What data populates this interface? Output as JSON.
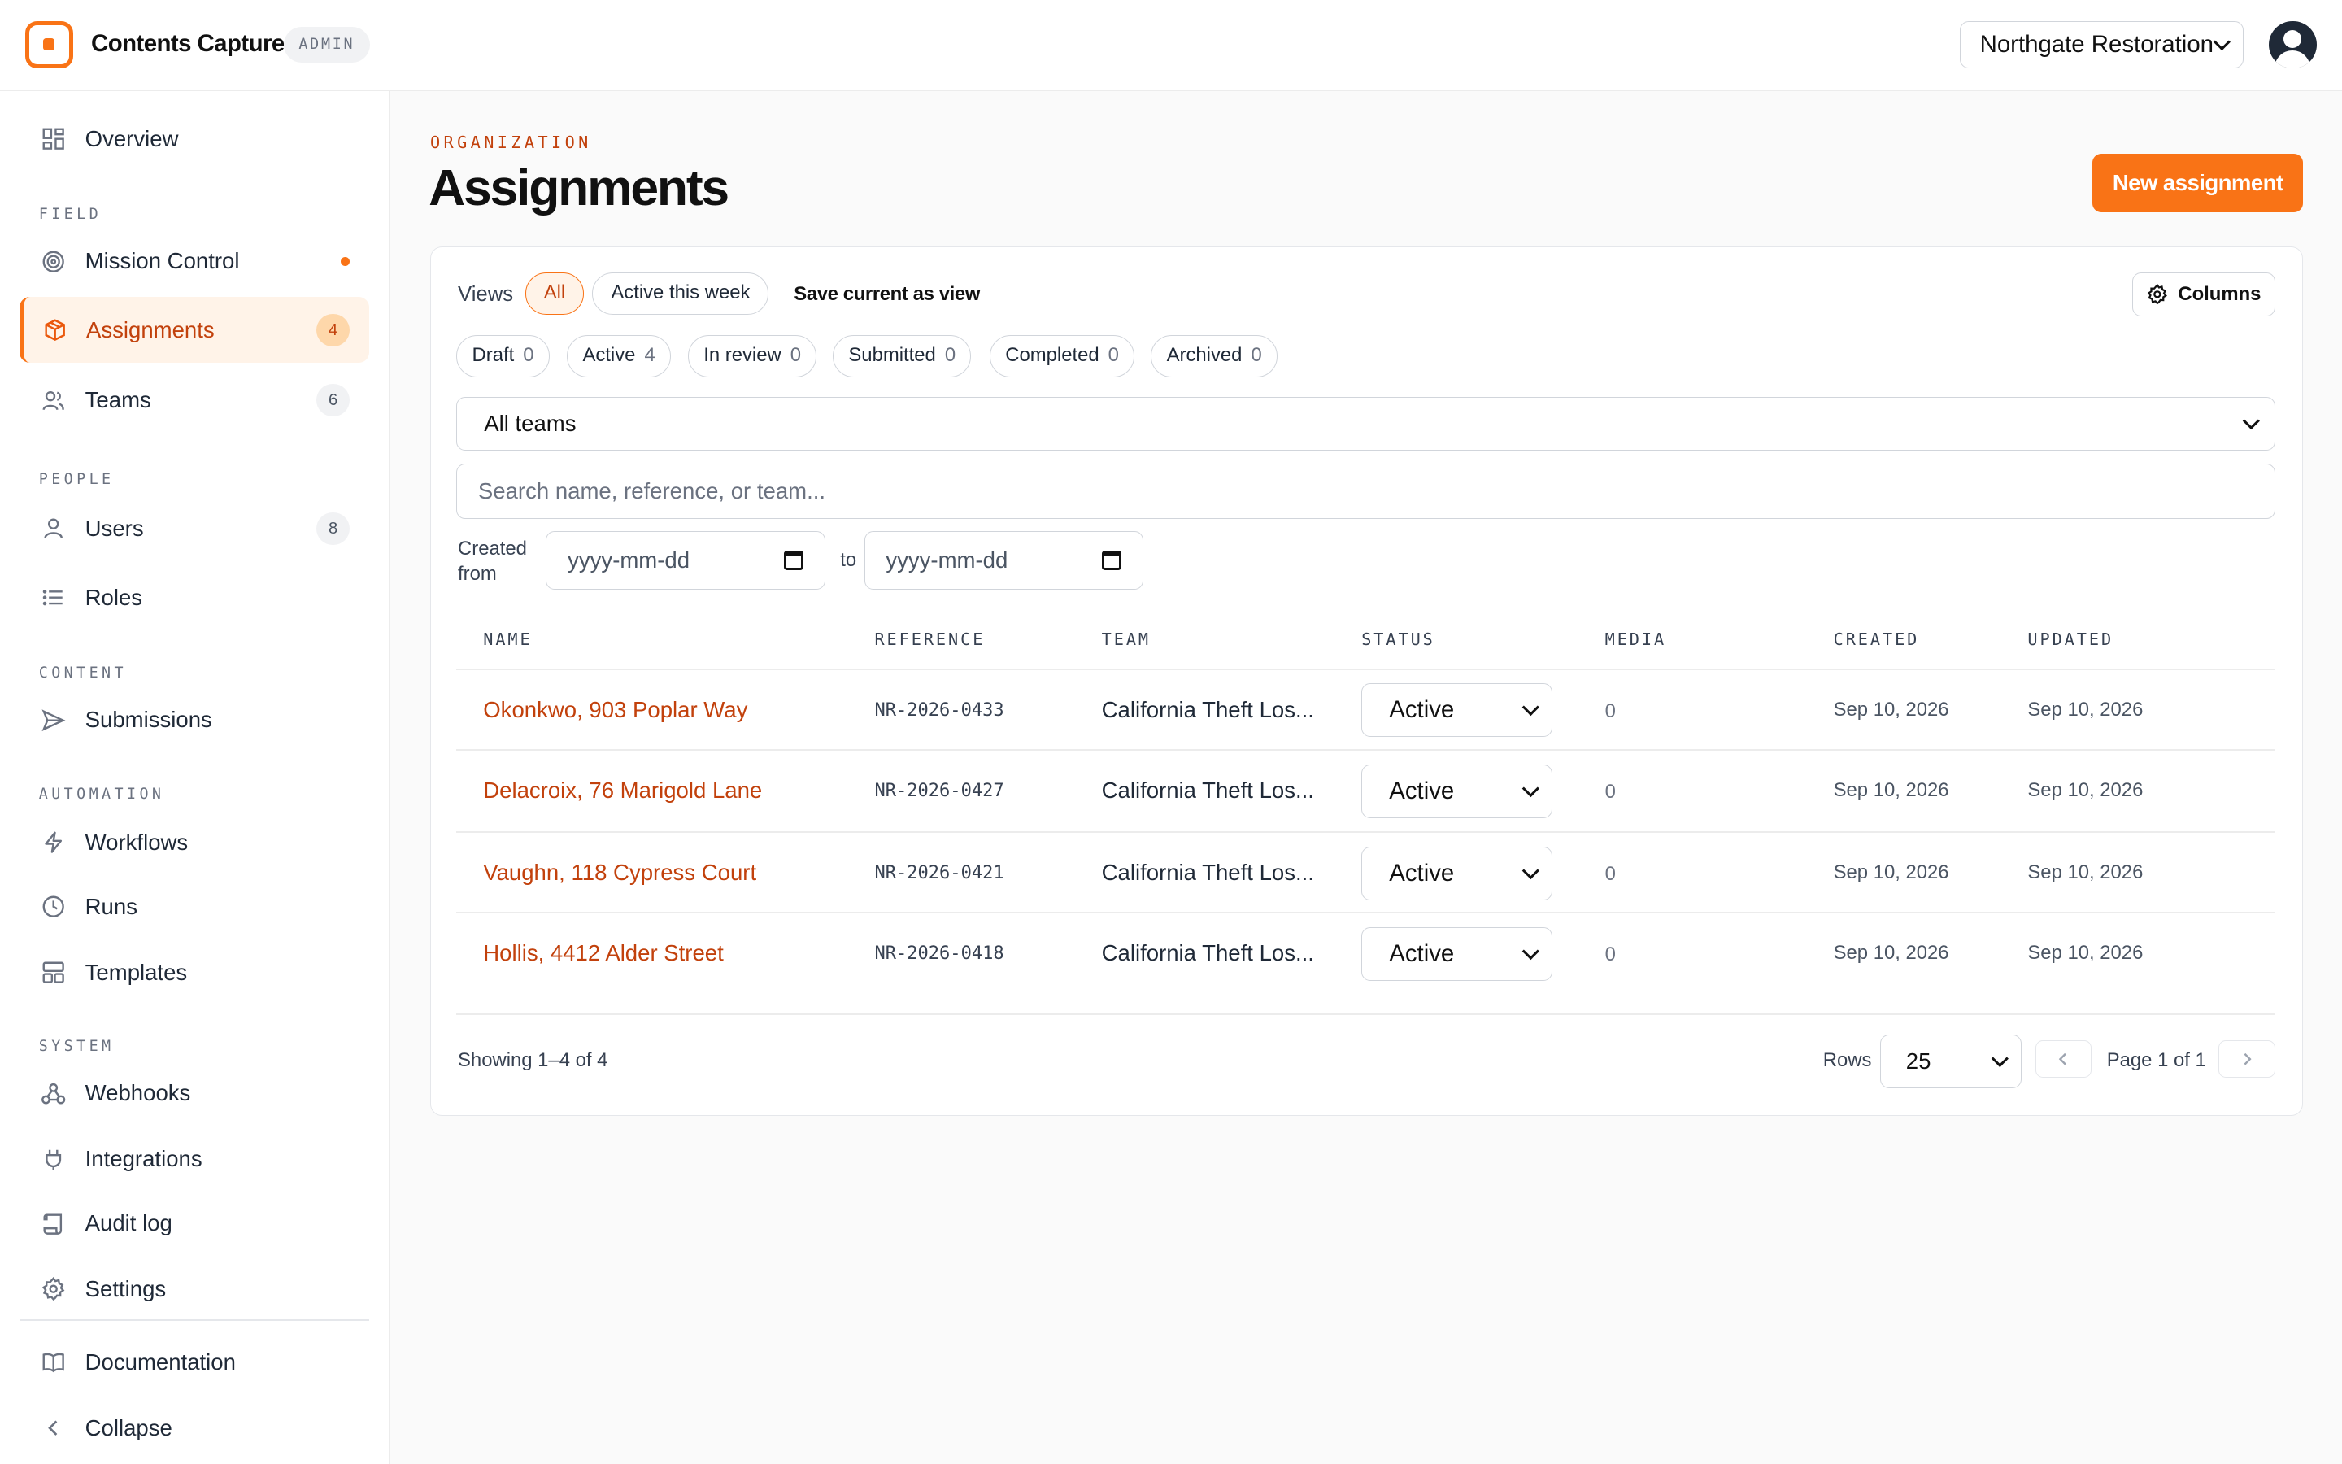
{
  "app": {
    "name": "Contents Capture",
    "badge": "ADMIN"
  },
  "org_selector": {
    "value": "Northgate Restoration"
  },
  "sidebar": {
    "overview": "Overview",
    "sections": {
      "field": "FIELD",
      "people": "PEOPLE",
      "content": "CONTENT",
      "automation": "AUTOMATION",
      "system": "SYSTEM"
    },
    "mission_control": "Mission Control",
    "assignments": {
      "label": "Assignments",
      "count": "4"
    },
    "teams": {
      "label": "Teams",
      "count": "6"
    },
    "users": {
      "label": "Users",
      "count": "8"
    },
    "roles": "Roles",
    "submissions": "Submissions",
    "workflows": "Workflows",
    "runs": "Runs",
    "templates": "Templates",
    "webhooks": "Webhooks",
    "integrations": "Integrations",
    "audit_log": "Audit log",
    "settings": "Settings",
    "documentation": "Documentation",
    "collapse": "Collapse"
  },
  "header": {
    "eyebrow": "ORGANIZATION",
    "title": "Assignments",
    "new_button": "New assignment"
  },
  "views": {
    "label": "Views",
    "items": [
      "All",
      "Active this week"
    ],
    "save": "Save current as view",
    "columns_button": "Columns"
  },
  "status_chips": [
    {
      "label": "Draft",
      "count": "0"
    },
    {
      "label": "Active",
      "count": "4"
    },
    {
      "label": "In review",
      "count": "0"
    },
    {
      "label": "Submitted",
      "count": "0"
    },
    {
      "label": "Completed",
      "count": "0"
    },
    {
      "label": "Archived",
      "count": "0"
    }
  ],
  "filters": {
    "team": "All teams",
    "search_placeholder": "Search name, reference, or team...",
    "created_label": "Created from",
    "date_placeholder": "yyyy-mm-dd",
    "to": "to"
  },
  "table": {
    "headers": [
      "NAME",
      "REFERENCE",
      "TEAM",
      "STATUS",
      "MEDIA",
      "CREATED",
      "UPDATED"
    ],
    "rows": [
      {
        "name": "Okonkwo, 903 Poplar Way",
        "reference": "NR-2026-0433",
        "team": "California Theft Los...",
        "status": "Active",
        "media": "0",
        "created": "Sep 10, 2026",
        "updated": "Sep 10, 2026"
      },
      {
        "name": "Delacroix, 76 Marigold Lane",
        "reference": "NR-2026-0427",
        "team": "California Theft Los...",
        "status": "Active",
        "media": "0",
        "created": "Sep 10, 2026",
        "updated": "Sep 10, 2026"
      },
      {
        "name": "Vaughn, 118 Cypress Court",
        "reference": "NR-2026-0421",
        "team": "California Theft Los...",
        "status": "Active",
        "media": "0",
        "created": "Sep 10, 2026",
        "updated": "Sep 10, 2026"
      },
      {
        "name": "Hollis, 4412 Alder Street",
        "reference": "NR-2026-0418",
        "team": "California Theft Los...",
        "status": "Active",
        "media": "0",
        "created": "Sep 10, 2026",
        "updated": "Sep 10, 2026"
      }
    ]
  },
  "pagination": {
    "showing": "Showing 1–4 of 4",
    "rows_label": "Rows",
    "rows_value": "25",
    "page_label": "Page 1 of 1"
  },
  "colors": {
    "accent": "#f97316",
    "accent_text": "#c2410c",
    "accent_bg": "#fff3e8"
  }
}
